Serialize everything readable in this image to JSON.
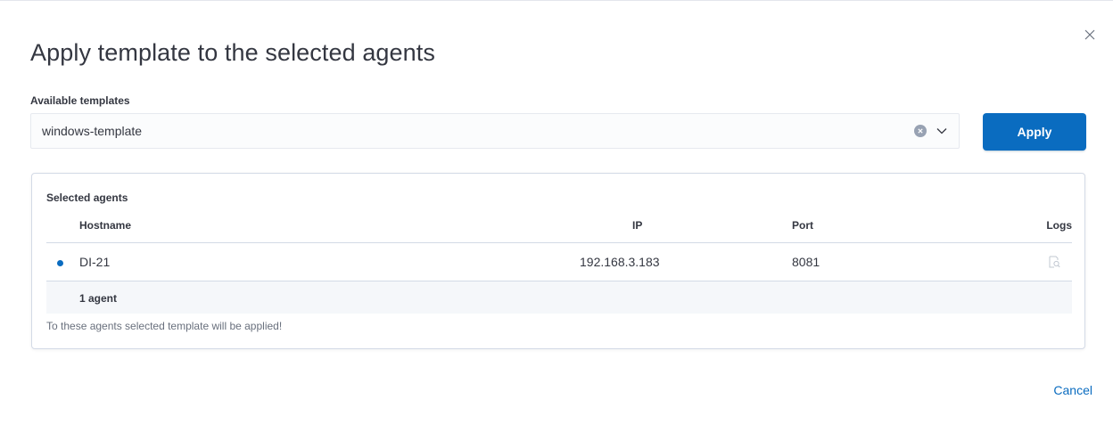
{
  "modal": {
    "title": "Apply template to the selected agents",
    "close_icon": "close-icon"
  },
  "template_field": {
    "label": "Available templates",
    "value": "windows-template",
    "clear_icon": "clear-icon",
    "toggle_icon": "chevron-down-icon"
  },
  "apply_button": {
    "label": "Apply",
    "color": "#0a6cc0"
  },
  "agents_panel": {
    "title": "Selected agents",
    "columns": {
      "hostname": "Hostname",
      "ip": "IP",
      "port": "Port",
      "logs": "Logs"
    },
    "rows": [
      {
        "hostname": "DI-21",
        "ip": "192.168.3.183",
        "port": "8081",
        "status_color": "#0a6cc0",
        "logs_icon": "logs-search-icon"
      }
    ],
    "footer": "1 agent",
    "helper_text": "To these agents selected template will be applied!"
  },
  "cancel_link": {
    "label": "Cancel",
    "color": "#0a6cc0"
  }
}
